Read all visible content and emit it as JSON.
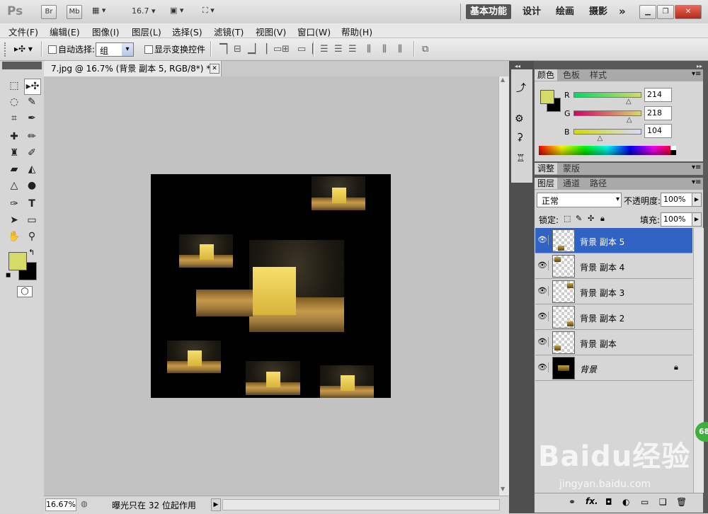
{
  "titlebar": {
    "logo": "Ps",
    "bridge_btn": "Br",
    "minibridge_btn": "Mb",
    "zoom_value": "16.7",
    "workspaces": [
      "基本功能",
      "设计",
      "绘画",
      "摄影"
    ],
    "more": "»"
  },
  "menubar": {
    "items": [
      "文件(F)",
      "编辑(E)",
      "图像(I)",
      "图层(L)",
      "选择(S)",
      "滤镜(T)",
      "视图(V)",
      "窗口(W)",
      "帮助(H)"
    ]
  },
  "options": {
    "auto_select_label": "自动选择:",
    "auto_select_value": "组",
    "show_transform_label": "显示变换控件"
  },
  "document": {
    "tab_title": "7.jpg @ 16.7% (背景 副本 5, RGB/8*) *",
    "zoom": "16.67%",
    "status_text": "曝光只在 32 位起作用"
  },
  "color_panel": {
    "tabs": [
      "颜色",
      "色板",
      "样式"
    ],
    "r_label": "R",
    "g_label": "G",
    "b_label": "B",
    "r": "214",
    "g": "218",
    "b": "104",
    "r_level": 0.84,
    "g_level": 0.85,
    "b_level": 0.41,
    "foreground": "#d6da68",
    "background": "#000000"
  },
  "adjust_panel": {
    "tabs": [
      "调整",
      "蒙版"
    ]
  },
  "layers_panel": {
    "tabs": [
      "图层",
      "通道",
      "路径"
    ],
    "blend_mode": "正常",
    "opacity_label": "不透明度:",
    "opacity": "100%",
    "lock_label": "锁定:",
    "fill_label": "填充:",
    "fill": "100%",
    "layers": [
      {
        "name": "背景 副本 5",
        "selected": true
      },
      {
        "name": "背景 副本 4",
        "selected": false
      },
      {
        "name": "背景 副本 3",
        "selected": false
      },
      {
        "name": "背景 副本 2",
        "selected": false
      },
      {
        "name": "背景 副本",
        "selected": false
      },
      {
        "name": "背景",
        "selected": false
      }
    ],
    "footer_icons": [
      "link-icon",
      "fx-icon",
      "mask-icon",
      "adjustment-icon",
      "folder-icon",
      "new-layer-icon",
      "trash-icon"
    ]
  },
  "watermark": {
    "brand": "Baidu经验",
    "url": "jingyan.baidu.com",
    "badge": "68"
  }
}
